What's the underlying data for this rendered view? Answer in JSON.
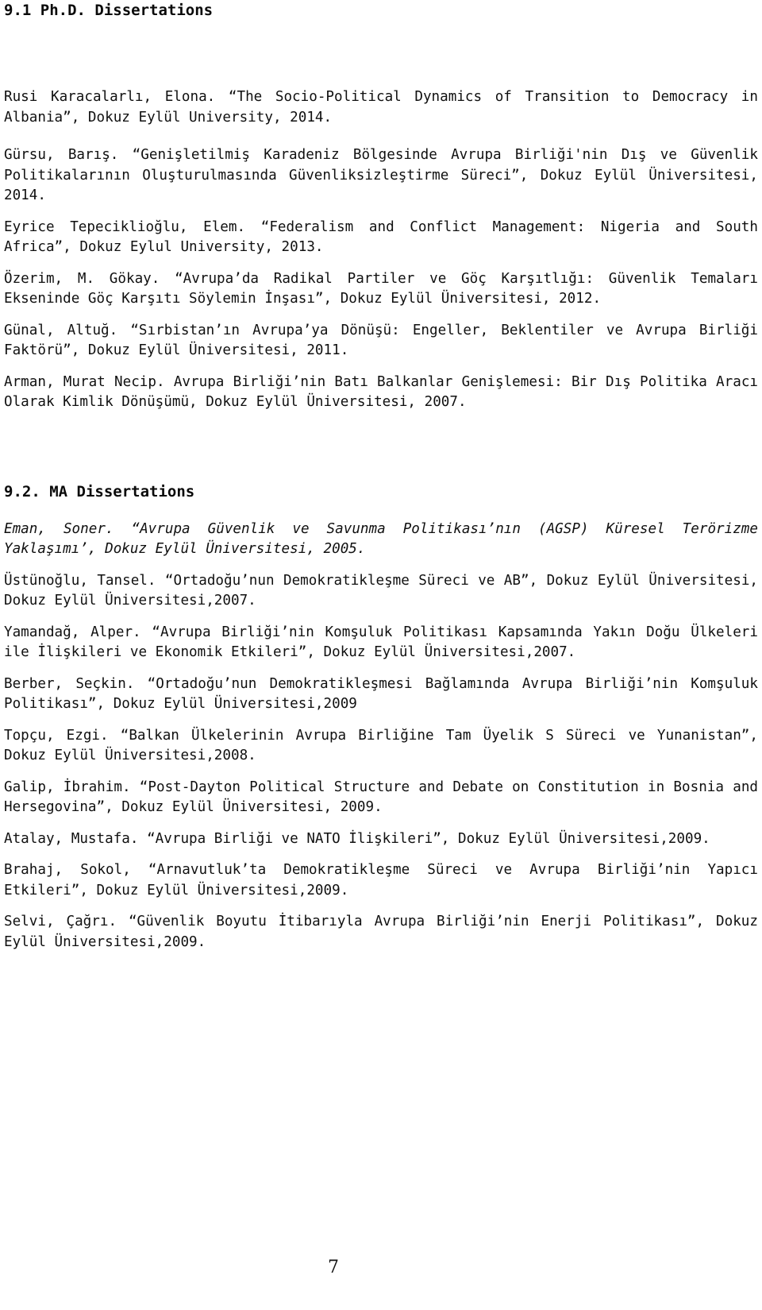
{
  "document": {
    "page_number": "7",
    "sections": [
      {
        "id": "phd",
        "heading": "9.1 Ph.D. Dissertations",
        "entries": [
          {
            "id": "phd-1",
            "style": "normal",
            "text": "Rusi Karacalarlı, Elona. “The Socio-Political Dynamics of Transition to Democracy in Albania”, Dokuz Eylül University, 2014."
          },
          {
            "id": "phd-2",
            "style": "normal",
            "text": "Gürsu, Barış. “Genişletilmiş Karadeniz Bölgesinde Avrupa Birliği'nin Dış ve Güvenlik Politikalarının Oluşturulmasında Güvenliksizleştirme Süreci”, Dokuz Eylül Üniversitesi, 2014."
          },
          {
            "id": "phd-3",
            "style": "normal",
            "text": "Eyrice Tepeciklioğlu, Elem. “Federalism and Conflict Management: Nigeria and South Africa”, Dokuz Eylul University, 2013."
          },
          {
            "id": "phd-4",
            "style": "normal",
            "text": "Özerim, M. Gökay. “Avrupa’da Radikal Partiler ve Göç Karşıtlığı: Güvenlik Temaları Ekseninde Göç Karşıtı Söylemin İnşası”, Dokuz Eylül Üniversitesi, 2012."
          },
          {
            "id": "phd-5",
            "style": "normal",
            "text": "Günal, Altuğ. “Sırbistan’ın Avrupa’ya Dönüşü: Engeller, Beklentiler ve Avrupa Birliği Faktörü”, Dokuz Eylül Üniversitesi, 2011."
          },
          {
            "id": "phd-6",
            "style": "normal",
            "text": "Arman, Murat Necip. Avrupa Birliği’nin Batı Balkanlar Genişlemesi: Bir Dış Politika Aracı Olarak Kimlik Dönüşümü, Dokuz Eylül Üniversitesi, 2007."
          }
        ]
      },
      {
        "id": "ma",
        "heading": "9.2. MA Dissertations",
        "entries": [
          {
            "id": "ma-1",
            "style": "italic-title",
            "text": "Eman, Soner.  “Avrupa Güvenlik ve Savunma Politikası’nın (AGSP) Küresel Terörizme Yaklaşımı’, Dokuz Eylül Üniversitesi, 2005."
          },
          {
            "id": "ma-2",
            "style": "normal",
            "text": "Üstünoğlu, Tansel. “Ortadoğu’nun Demokratikleşme Süreci ve AB”, Dokuz Eylül Üniversitesi, Dokuz Eylül Üniversitesi,2007."
          },
          {
            "id": "ma-3",
            "style": "normal",
            "text": "Yamandağ, Alper. “Avrupa Birliği’nin Komşuluk Politikası Kapsamında Yakın Doğu Ülkeleri ile İlişkileri ve Ekonomik Etkileri”, Dokuz Eylül Üniversitesi,2007."
          },
          {
            "id": "ma-4",
            "style": "normal",
            "text": "Berber, Seçkin. “Ortadoğu’nun Demokratikleşmesi Bağlamında Avrupa Birliği’nin Komşuluk Politikası”, Dokuz Eylül Üniversitesi,2009"
          },
          {
            "id": "ma-5",
            "style": "normal",
            "text": "Topçu, Ezgi. “Balkan Ülkelerinin Avrupa Birliğine Tam Üyelik S  Süreci          ve Yunanistan”, Dokuz Eylül Üniversitesi,2008."
          },
          {
            "id": "ma-6",
            "style": "normal",
            "text": "Galip, İbrahim. “Post-Dayton Political Structure and Debate on Constitution in Bosnia and Hersegovina”, Dokuz Eylül Üniversitesi, 2009."
          },
          {
            "id": "ma-7",
            "style": "normal",
            "text": "Atalay, Mustafa. “Avrupa Birliği ve NATO İlişkileri”, Dokuz Eylül Üniversitesi,2009."
          },
          {
            "id": "ma-8",
            "style": "normal",
            "text": "Brahaj, Sokol, “Arnavutluk’ta Demokratikleşme Süreci ve Avrupa Birliği’nin Yapıcı Etkileri”, Dokuz Eylül Üniversitesi,2009."
          },
          {
            "id": "ma-9",
            "style": "normal",
            "text": "Selvi, Çağrı. “Güvenlik Boyutu İtibarıyla Avrupa Birliği’nin Enerji Politikası”, Dokuz Eylül Üniversitesi,2009."
          }
        ]
      }
    ]
  }
}
